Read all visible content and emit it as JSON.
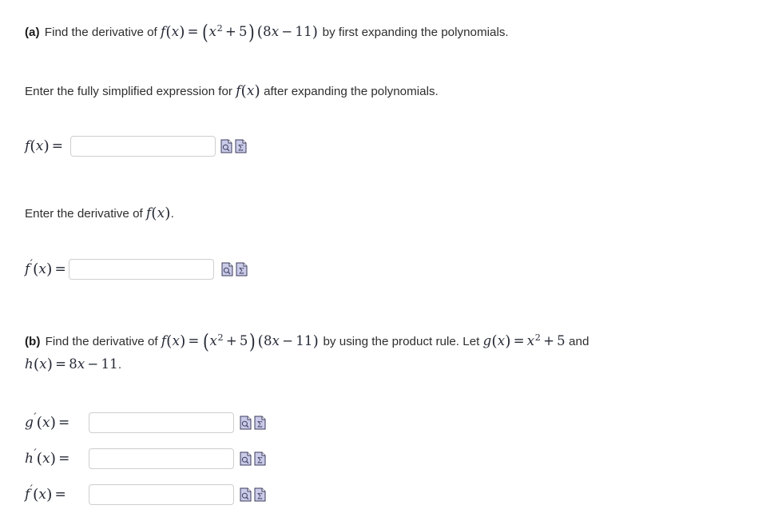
{
  "page": {
    "background_color": "#ffffff",
    "text_color": "#2e2e2e",
    "math_color": "#262a36",
    "input_border_color": "#cfcfcf",
    "icon_fill_color": "#c9cbe8",
    "icon_stroke_color": "#3b3b5c"
  },
  "part_a": {
    "marker": "(a)",
    "text_before": "Find the derivative of",
    "equation": {
      "lhs_fn": "f",
      "lhs_var": "x",
      "eq": "=",
      "factor1": {
        "base": "x",
        "exponent": "2",
        "op": "+",
        "term": "5"
      },
      "factor2": {
        "coef": "8",
        "var": "x",
        "op": "−",
        "term": "11"
      }
    },
    "text_after": "by first expanding the polynomials.",
    "instruction": {
      "text_before": "Enter the fully simplified expression for",
      "fn": "f",
      "var": "x",
      "text_after": "after expanding the polynomials."
    },
    "field_fx": {
      "label_fn": "f",
      "label_var": "x",
      "label_eq": "=",
      "value": "",
      "placeholder": ""
    },
    "instruction2": {
      "text_before": "Enter the derivative of",
      "fn": "f",
      "var": "x",
      "text_after": "."
    },
    "field_fprime": {
      "label_fn": "f",
      "label_prime": "′",
      "label_var": "x",
      "label_eq": "=",
      "value": "",
      "placeholder": ""
    }
  },
  "part_b": {
    "marker": "(b)",
    "text_before": "Find the derivative of",
    "equation": {
      "lhs_fn": "f",
      "lhs_var": "x",
      "eq": "=",
      "factor1": {
        "base": "x",
        "exponent": "2",
        "op": "+",
        "term": "5"
      },
      "factor2": {
        "coef": "8",
        "var": "x",
        "op": "−",
        "term": "11"
      }
    },
    "text_middle": "by using the product rule. Let",
    "g_def": {
      "fn": "g",
      "var": "x",
      "eq": "=",
      "base": "x",
      "exponent": "2",
      "op": "+",
      "term": "5"
    },
    "text_and": "and",
    "h_def": {
      "fn": "h",
      "var": "x",
      "eq": "=",
      "coef": "8",
      "hvar": "x",
      "op": "−",
      "term": "11"
    },
    "h_period": ".",
    "field_gprime": {
      "label_fn": "g",
      "label_prime": "′",
      "label_var": "x",
      "label_eq": "=",
      "value": "",
      "placeholder": ""
    },
    "field_hprime": {
      "label_fn": "h",
      "label_prime": "′",
      "label_var": "x",
      "label_eq": "=",
      "value": "",
      "placeholder": ""
    },
    "field_fprime": {
      "label_fn": "f",
      "label_prime": "′",
      "label_var": "x",
      "label_eq": "=",
      "value": "",
      "placeholder": ""
    }
  },
  "icons": {
    "preview": {
      "name": "preview-document-icon",
      "glyph": "⌕",
      "title": "Preview"
    },
    "equation_editor": {
      "name": "equation-editor-icon",
      "glyph": "Σ",
      "title": "Equation Editor"
    }
  }
}
